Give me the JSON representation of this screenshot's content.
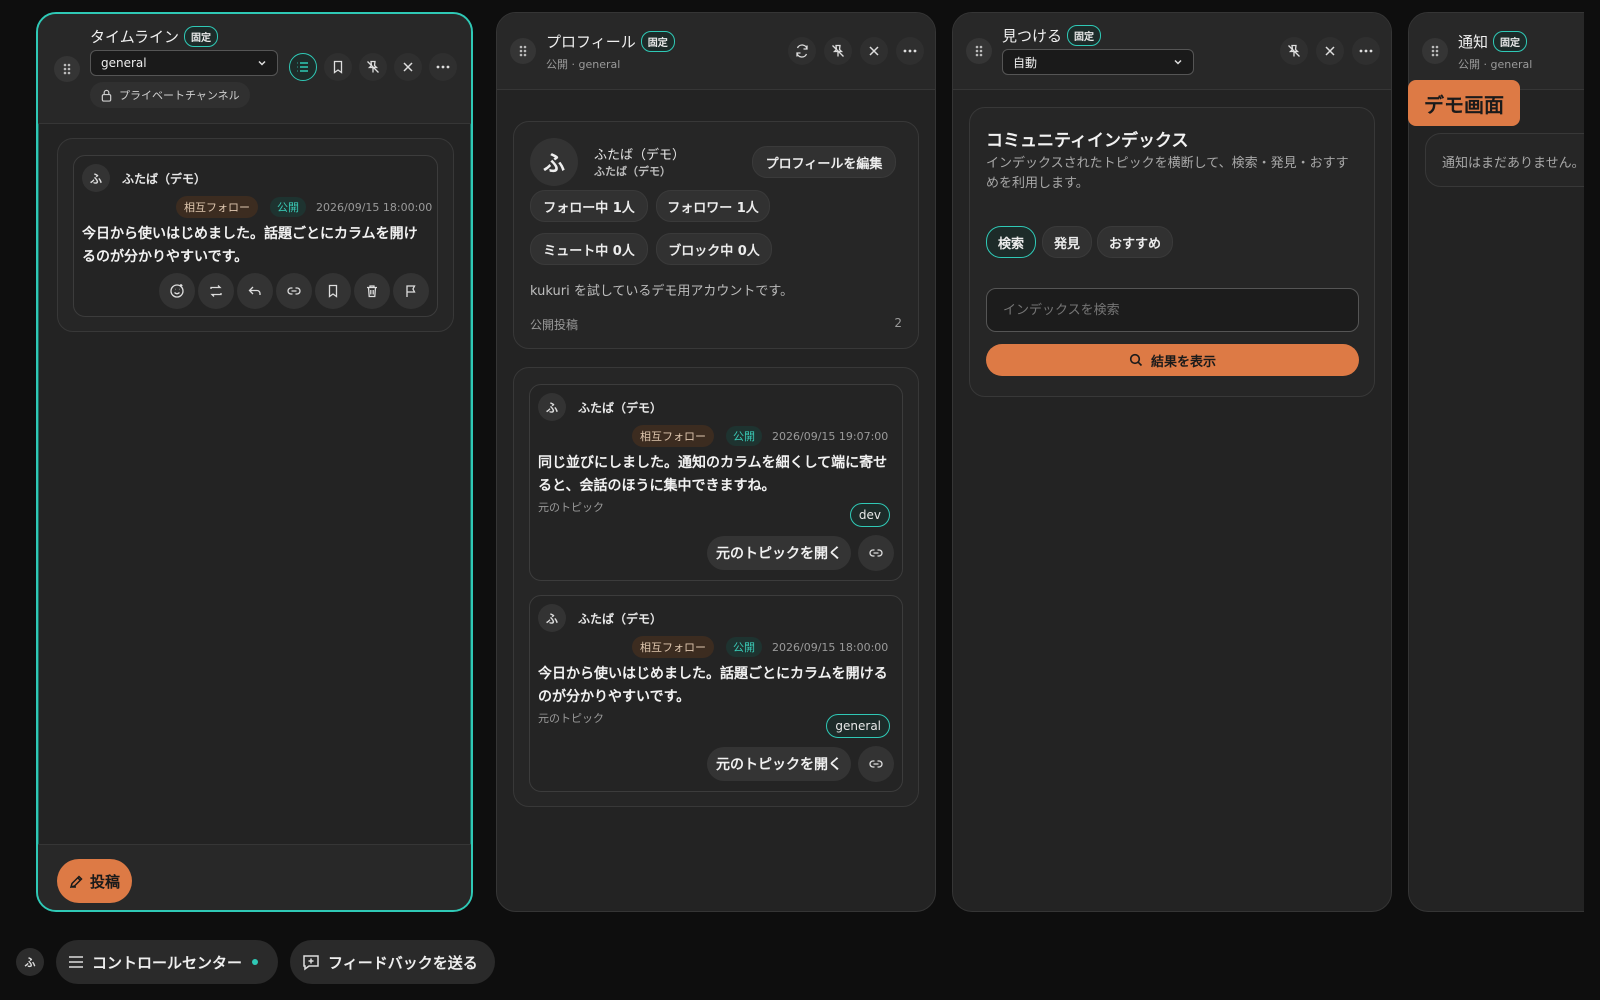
{
  "timeline": {
    "title": "タイムライン",
    "pinned": "固定",
    "channel": "general",
    "private_channel": "プライベートチャンネル",
    "post": {
      "author": "ふたば（デモ）",
      "avatar": "ふ",
      "follow_badge": "相互フォロー",
      "visibility": "公開",
      "timestamp": "2026/09/15 18:00:00",
      "body": "今日から使いはじめました。話題ごとにカラムを開けるのが分かりやすいです。"
    },
    "compose_label": "投稿"
  },
  "profile": {
    "title": "プロフィール",
    "pinned": "固定",
    "subtitle": "公開 · general",
    "avatar": "ふ",
    "name": "ふたば（デモ）",
    "handle": "ふたば（デモ）",
    "edit_label": "プロフィールを編集",
    "following": "フォロー中 1人",
    "followers": "フォロワー 1人",
    "muted": "ミュート中 0人",
    "blocked": "ブロック中 0人",
    "bio": "kukuri を試しているデモ用アカウントです。",
    "public_posts_label": "公開投稿",
    "public_posts_count": "2",
    "posts": [
      {
        "author": "ふたば（デモ）",
        "avatar": "ふ",
        "follow_badge": "相互フォロー",
        "visibility": "公開",
        "timestamp": "2026/09/15 19:07:00",
        "body": "同じ並びにしました。通知のカラムを細くして端に寄せると、会話のほうに集中できますね。",
        "origin_label": "元のトピック",
        "tag": "dev",
        "open_label": "元のトピックを開く"
      },
      {
        "author": "ふたば（デモ）",
        "avatar": "ふ",
        "follow_badge": "相互フォロー",
        "visibility": "公開",
        "timestamp": "2026/09/15 18:00:00",
        "body": "今日から使いはじめました。話題ごとにカラムを開けるのが分かりやすいです。",
        "origin_label": "元のトピック",
        "tag": "general",
        "open_label": "元のトピックを開く"
      }
    ]
  },
  "discover": {
    "title": "見つける",
    "pinned": "固定",
    "mode": "自動",
    "heading": "コミュニティインデックス",
    "description": "インデックスされたトピックを横断して、検索・発見・おすすめを利用します。",
    "tabs": [
      "検索",
      "発見",
      "おすすめ"
    ],
    "search_placeholder": "インデックスを検索",
    "show_results_label": "結果を表示"
  },
  "notifications": {
    "title": "通知",
    "pinned": "固定",
    "subtitle": "公開 · general",
    "empty": "通知はまだありません。"
  },
  "demo_label": "デモ画面",
  "bottom_bar": {
    "avatar": "ふ",
    "control_center": "コントロールセンター",
    "feedback": "フィードバックを送る"
  },
  "colors": {
    "accent": "#2fc9b6",
    "orange": "#dd7a45",
    "background": "#0e0e0e",
    "panel": "#232323"
  }
}
